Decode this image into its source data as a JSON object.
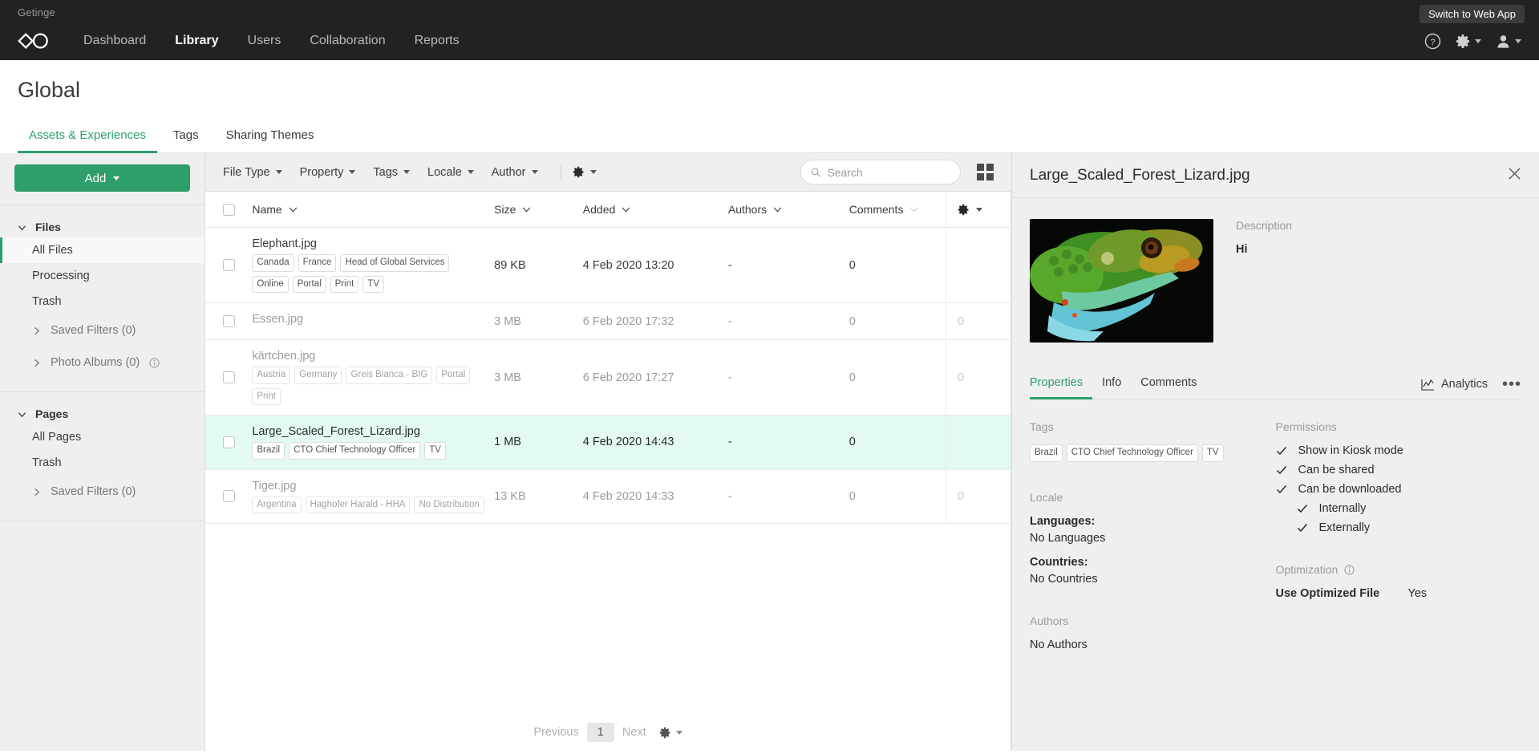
{
  "topbar": {
    "brand": "Getinge",
    "switch_label": "Switch to Web App",
    "nav": [
      {
        "label": "Dashboard",
        "active": false
      },
      {
        "label": "Library",
        "active": true
      },
      {
        "label": "Users",
        "active": false
      },
      {
        "label": "Collaboration",
        "active": false
      },
      {
        "label": "Reports",
        "active": false
      }
    ]
  },
  "page": {
    "title": "Global",
    "tabs": [
      {
        "label": "Assets & Experiences",
        "active": true
      },
      {
        "label": "Tags",
        "active": false
      },
      {
        "label": "Sharing Themes",
        "active": false
      }
    ]
  },
  "sidebar": {
    "add_label": "Add",
    "groups": [
      {
        "title": "Files",
        "items": [
          {
            "label": "All Files",
            "active": true
          },
          {
            "label": "Processing",
            "active": false
          },
          {
            "label": "Trash",
            "active": false
          }
        ],
        "subs": [
          {
            "label": "Saved Filters (0)",
            "info": false
          },
          {
            "label": "Photo Albums (0)",
            "info": true
          }
        ]
      },
      {
        "title": "Pages",
        "items": [
          {
            "label": "All Pages",
            "active": false
          },
          {
            "label": "Trash",
            "active": false
          }
        ],
        "subs": [
          {
            "label": "Saved Filters (0)",
            "info": false
          }
        ]
      }
    ]
  },
  "filterbar": {
    "filters": [
      "File Type",
      "Property",
      "Tags",
      "Locale",
      "Author"
    ],
    "search_placeholder": "Search",
    "search_value": ""
  },
  "table": {
    "columns": [
      "Name",
      "Size",
      "Added",
      "Authors",
      "Comments"
    ],
    "rows": [
      {
        "name": "Elephant.jpg",
        "tags": [
          "Canada",
          "France",
          "Head of Global Services",
          "Online",
          "Portal",
          "Print",
          "TV"
        ],
        "size": "89 KB",
        "added": "4 Feb 2020 13:20",
        "authors": "-",
        "comments": "0",
        "extra": "",
        "dim": false,
        "selected": false
      },
      {
        "name": "Essen.jpg",
        "tags": [],
        "size": "3 MB",
        "added": "6 Feb 2020 17:32",
        "authors": "-",
        "comments": "0",
        "extra": "0",
        "dim": true,
        "selected": false
      },
      {
        "name": "kärtchen.jpg",
        "tags": [
          "Austria",
          "Germany",
          "Greis Bianca - BIG",
          "Portal",
          "Print"
        ],
        "size": "3 MB",
        "added": "6 Feb 2020 17:27",
        "authors": "-",
        "comments": "0",
        "extra": "0",
        "dim": true,
        "selected": false
      },
      {
        "name": "Large_Scaled_Forest_Lizard.jpg",
        "tags": [
          "Brazil",
          "CTO Chief Technology Officer",
          "TV"
        ],
        "size": "1 MB",
        "added": "4 Feb 2020 14:43",
        "authors": "-",
        "comments": "0",
        "extra": "",
        "dim": false,
        "selected": true
      },
      {
        "name": "Tiger.jpg",
        "tags": [
          "Argentina",
          "Haghofer Harald - HHA",
          "No Distribution"
        ],
        "size": "13 KB",
        "added": "4 Feb 2020 14:33",
        "authors": "-",
        "comments": "0",
        "extra": "0",
        "dim": true,
        "selected": false
      }
    ]
  },
  "pager": {
    "previous": "Previous",
    "page": "1",
    "next": "Next"
  },
  "detail": {
    "title": "Large_Scaled_Forest_Lizard.jpg",
    "description_label": "Description",
    "description_value": "Hi",
    "tabs": [
      {
        "label": "Properties",
        "active": true
      },
      {
        "label": "Info",
        "active": false
      },
      {
        "label": "Comments",
        "active": false
      }
    ],
    "analytics_label": "Analytics",
    "tags_label": "Tags",
    "tags": [
      "Brazil",
      "CTO Chief Technology Officer",
      "TV"
    ],
    "locale_label": "Locale",
    "languages_key": "Languages:",
    "languages_value": "No Languages",
    "countries_key": "Countries:",
    "countries_value": "No Countries",
    "authors_label": "Authors",
    "authors_value": "No Authors",
    "permissions_label": "Permissions",
    "permissions": [
      {
        "label": "Show in Kiosk mode",
        "indent": false
      },
      {
        "label": "Can be shared",
        "indent": false
      },
      {
        "label": "Can be downloaded",
        "indent": false
      },
      {
        "label": "Internally",
        "indent": true
      },
      {
        "label": "Externally",
        "indent": true
      }
    ],
    "optimization_label": "Optimization",
    "optimized_key": "Use Optimized File",
    "optimized_value": "Yes"
  },
  "colors": {
    "accent": "#2e9e6b",
    "topbar": "#222222",
    "selected_row": "#e2faf0"
  }
}
